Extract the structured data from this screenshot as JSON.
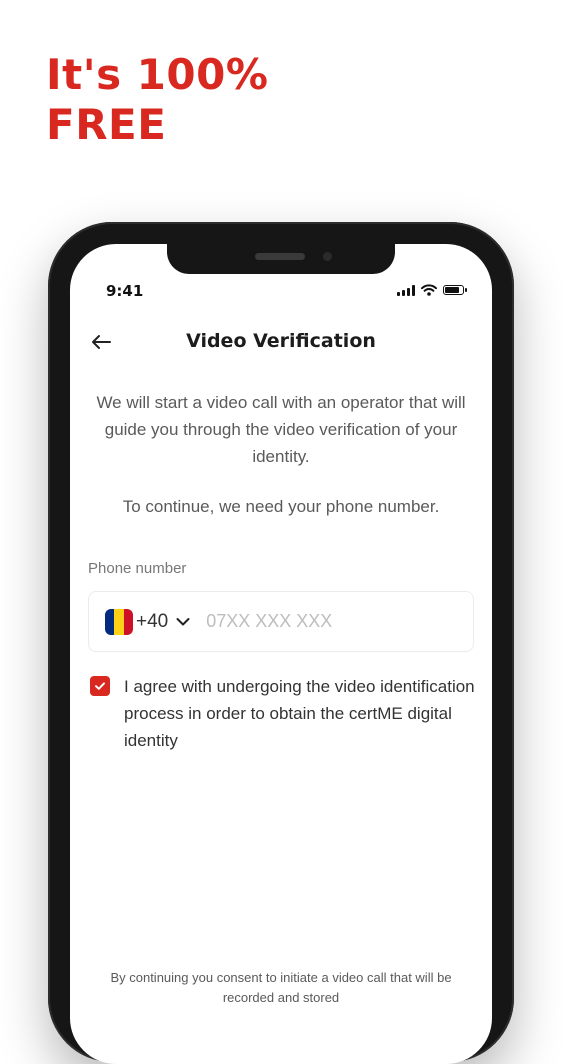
{
  "promo": {
    "line1": "It's 100%",
    "line2": "FREE"
  },
  "status_bar": {
    "time": "9:41",
    "battery_level": 0.85
  },
  "header": {
    "title": "Video Verification",
    "back_icon": "arrow-left-icon"
  },
  "content": {
    "intro": "We will start a video call with an operator that will guide you through the video verification of your identity.",
    "need_phone": "To continue, we need your phone number."
  },
  "phone_field": {
    "label": "Phone number",
    "country_flag": "romania-flag",
    "country_code": "+40",
    "placeholder": "07XX XXX XXX",
    "value": ""
  },
  "agreement": {
    "checked": true,
    "text": "I agree with undergoing the video identification process in order to obtain the certME digital identity"
  },
  "footer": {
    "consent": "By continuing you consent to initiate a video call that will be recorded and stored"
  },
  "colors": {
    "accent": "#d8281f",
    "flag_blue": "#002b7f",
    "flag_yellow": "#fcd116",
    "flag_red": "#ce1126"
  }
}
